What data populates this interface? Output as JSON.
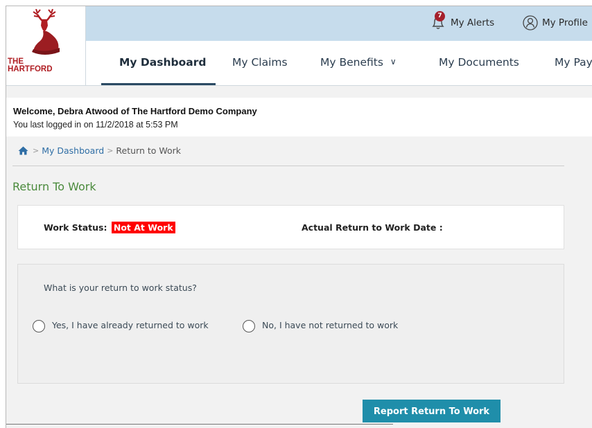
{
  "brand": {
    "line1": "THE",
    "line2": "HARTFORD",
    "logo_icon": "stag-icon",
    "colors": {
      "red": "#b01e23",
      "topbar": "#c6dcec",
      "accent": "#1f8eaa",
      "title_green": "#4a8a3c",
      "status_red": "#ff0000"
    }
  },
  "header": {
    "alerts_count": "7",
    "alerts_label": "My Alerts",
    "profile_label": "My Profile"
  },
  "nav": {
    "items": [
      {
        "label": "My Dashboard",
        "active": true
      },
      {
        "label": "My Claims"
      },
      {
        "label": "My Benefits"
      },
      {
        "label": "My Documents"
      },
      {
        "label": "My Pay"
      }
    ]
  },
  "welcome": {
    "line1": "Welcome, Debra Atwood of The Hartford Demo Company",
    "line2": "You last logged in on 11/2/2018 at 5:53 PM"
  },
  "breadcrumb": {
    "home_icon": "home-icon",
    "link": "My Dashboard",
    "current": "Return to Work"
  },
  "page": {
    "title": "Return To Work",
    "work_status_label": "Work Status:",
    "work_status_value": "Not At Work",
    "return_date_label": "Actual Return to Work Date :",
    "question": "What is your return to work status?",
    "options": [
      {
        "label": "Yes, I have already returned to work",
        "selected": false
      },
      {
        "label": "No, I have not returned to work",
        "selected": false
      }
    ],
    "submit_label": "Report Return To Work"
  }
}
